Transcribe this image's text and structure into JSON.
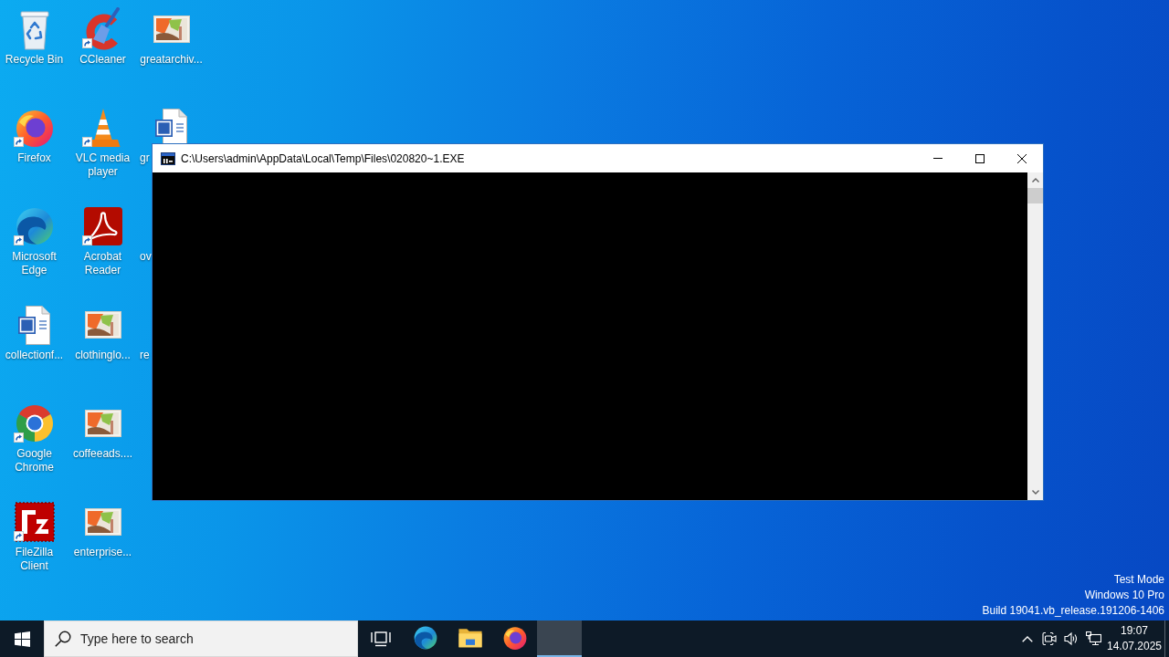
{
  "desktop": {
    "icons": [
      {
        "label": "Recycle Bin",
        "kind": "recycle-bin",
        "shortcut": false,
        "covered": false
      },
      {
        "label": "Firefox",
        "kind": "firefox",
        "shortcut": true,
        "covered": false
      },
      {
        "label": "Microsoft Edge",
        "kind": "edge",
        "shortcut": true,
        "covered": false
      },
      {
        "label": "collectionf...",
        "kind": "word-document",
        "shortcut": false,
        "covered": false
      },
      {
        "label": "Google Chrome",
        "kind": "chrome",
        "shortcut": true,
        "covered": false
      },
      {
        "label": "FileZilla Client",
        "kind": "filezilla",
        "shortcut": true,
        "covered": false
      },
      {
        "label": "CCleaner",
        "kind": "ccleaner",
        "shortcut": true,
        "covered": false
      },
      {
        "label": "VLC media player",
        "kind": "vlc",
        "shortcut": true,
        "covered": false
      },
      {
        "label": "Acrobat Reader",
        "kind": "acrobat",
        "shortcut": true,
        "covered": false
      },
      {
        "label": "clothinglo...",
        "kind": "image",
        "shortcut": false,
        "covered": false
      },
      {
        "label": "coffeeads....",
        "kind": "image",
        "shortcut": false,
        "covered": false
      },
      {
        "label": "enterprise...",
        "kind": "image",
        "shortcut": false,
        "covered": false
      },
      {
        "label": "greatarchiv...",
        "kind": "image",
        "shortcut": false,
        "covered": false
      },
      {
        "label": "gr",
        "kind": "word-document",
        "shortcut": false,
        "covered": true
      },
      {
        "label": "ov",
        "kind": "hidden",
        "shortcut": false,
        "covered": true
      },
      {
        "label": "re",
        "kind": "hidden",
        "shortcut": false,
        "covered": true
      }
    ],
    "system_text": [
      "Test Mode",
      "Windows 10 Pro",
      "Build 19041.vb_release.191206-1406"
    ]
  },
  "window": {
    "title": "C:\\Users\\admin\\AppData\\Local\\Temp\\Files\\020820~1.EXE"
  },
  "taskbar": {
    "search": {
      "placeholder": "Type here to search"
    },
    "apps": [
      {
        "kind": "task-view",
        "selected": false
      },
      {
        "kind": "edge",
        "selected": false
      },
      {
        "kind": "file-explorer",
        "selected": false
      },
      {
        "kind": "firefox",
        "selected": false
      },
      {
        "kind": "no-icon",
        "selected": true
      }
    ],
    "clock": {
      "time": "19:07",
      "date": "14.07.2025"
    }
  }
}
